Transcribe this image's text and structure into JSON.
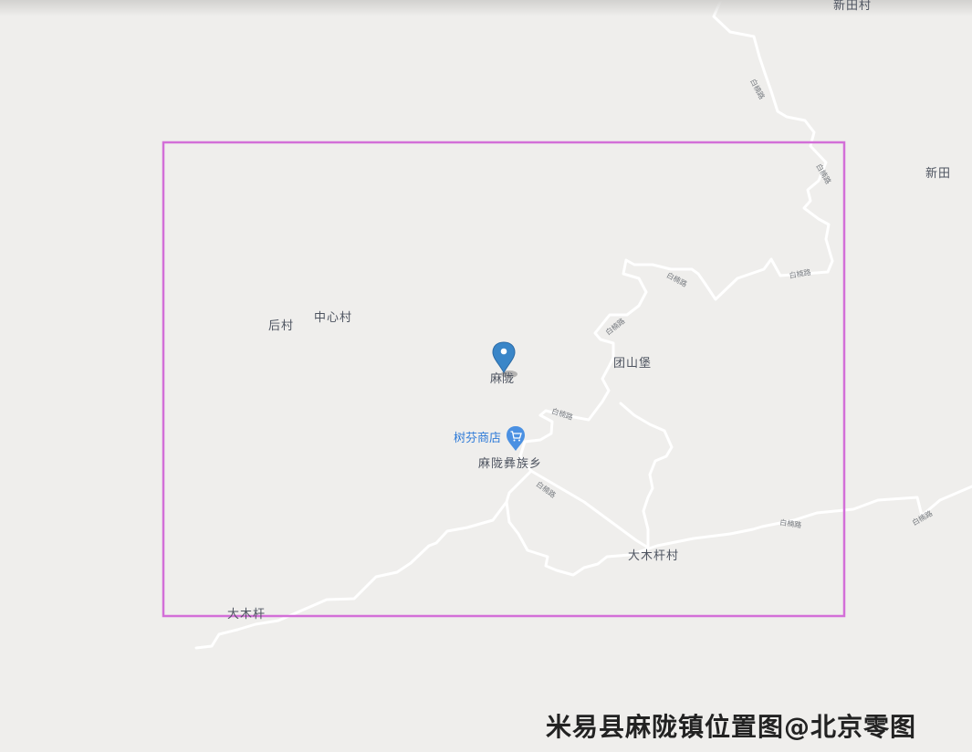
{
  "map": {
    "places": {
      "xintiancun": "新田村",
      "xintian": "新田",
      "houcun": "后村",
      "zhongxincun": "中心村",
      "malong": "麻陇",
      "tuanshanbao": "团山堡",
      "malong_township": "麻陇彝族乡",
      "damuqiancun": "大木杆村",
      "damuqian": "大木杆"
    },
    "shop": {
      "name": "树芬商店",
      "icon": "shopping-cart-icon"
    },
    "road_name": "白楠路",
    "marker_color": "#3a86c8",
    "selection_color": "#d36fd8"
  },
  "watermark": "米易县麻陇镇位置图@北京零图"
}
